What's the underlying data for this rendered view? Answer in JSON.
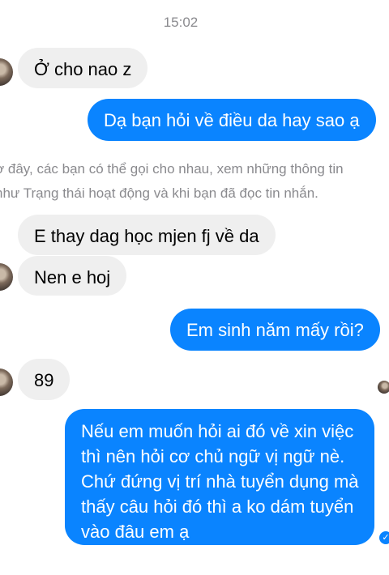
{
  "header": {
    "time": "15:02"
  },
  "notice": {
    "line1": "ờ đây, các bạn có thể gọi cho nhau, xem những thông tin",
    "line2": "như Trạng thái hoạt động và khi bạn đã đọc tin nhắn."
  },
  "messages": {
    "m1": "Ở cho nao z",
    "m2": "Dạ bạn hỏi về điều da hay sao ạ",
    "m3": "E thay dag học mjen fj về da",
    "m4": "Nen e hoj",
    "m5": "Em sinh năm mấy rồi?",
    "m6": "89",
    "m7": {
      "lines": [
        "Nếu em muốn hỏi ai đó về xin việc",
        "thì nên hỏi cơ chủ ngữ vị ngữ nè.",
        "Chứ đứng vị trí nhà tuyển dụng mà",
        "thấy câu hỏi đó thì a ko dám tuyển",
        "vào đâu em ạ"
      ]
    }
  },
  "icons": {
    "seen": "check-icon",
    "avatar": "profile-avatar"
  },
  "colors": {
    "outgoing": "#0a84ff",
    "incoming": "#efefef",
    "meta_text": "#8a8a8e"
  }
}
